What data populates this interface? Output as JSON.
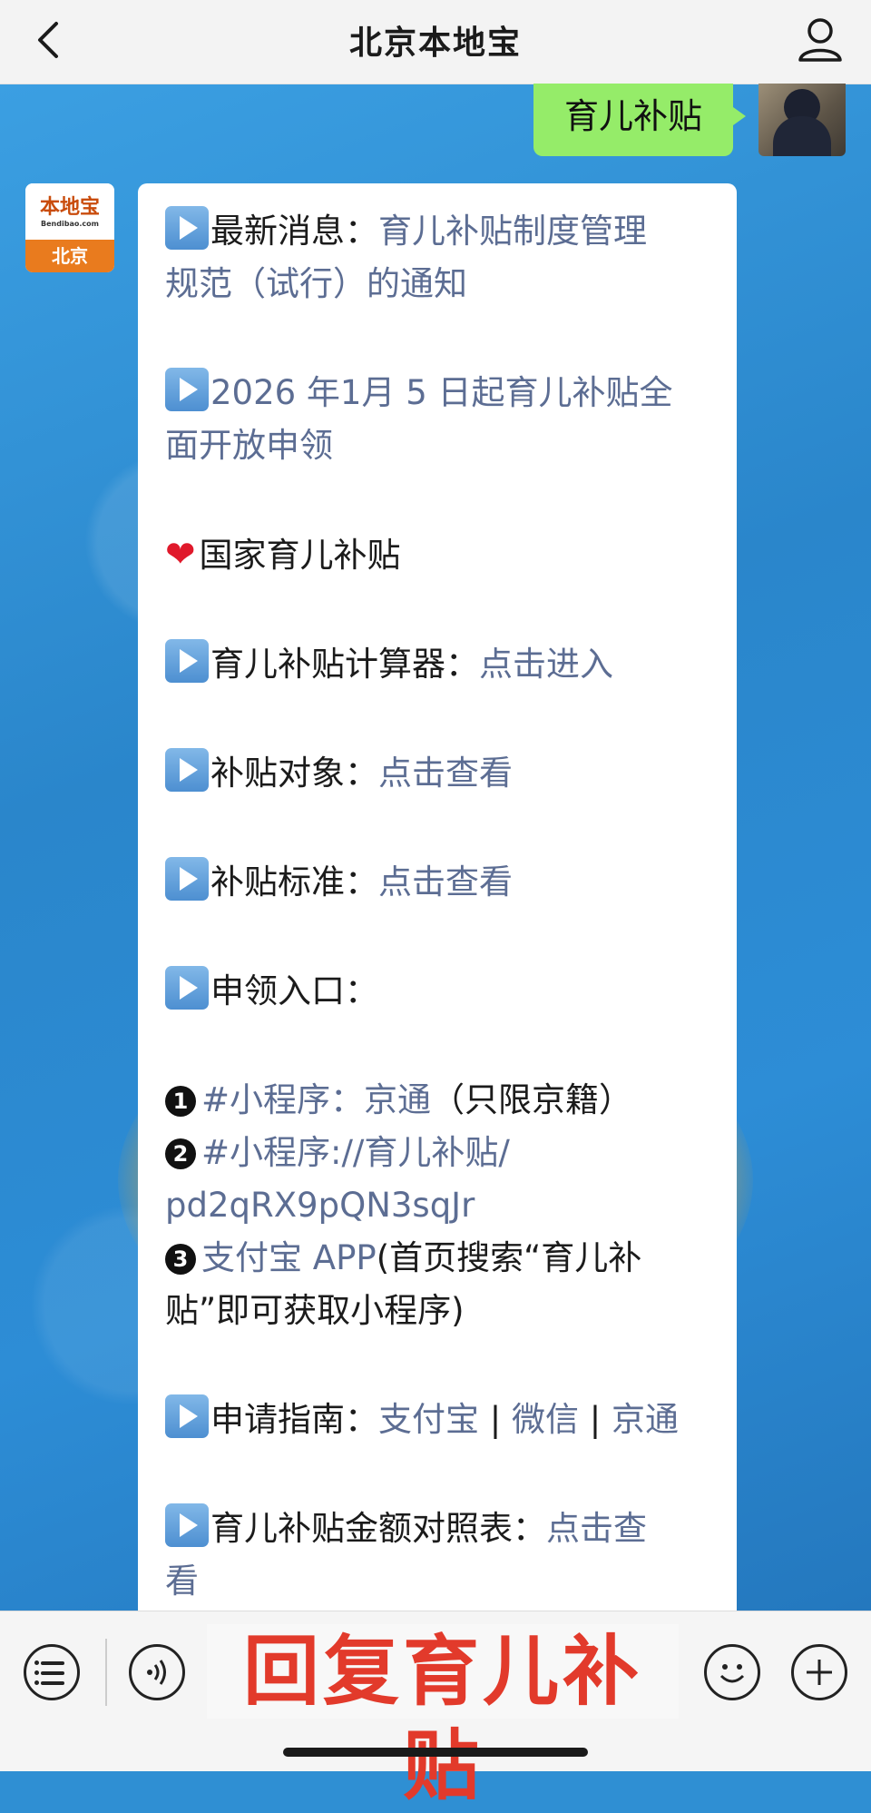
{
  "header": {
    "title": "北京本地宝"
  },
  "sent": {
    "text": "育儿补贴"
  },
  "bot": {
    "logo_main": "本地宝",
    "logo_sub": "Bendibao.com",
    "logo_city": "北京"
  },
  "message": {
    "l1_prefix": "最新消息：",
    "l1_link": "育儿补贴制度管理",
    "l1_link2": "规范（试行）的通知",
    "l2_link": "2026 年1月 5 日起育儿补贴全",
    "l2_link2": "面开放申领",
    "l3": "国家育儿补贴",
    "l4_prefix": "育儿补贴计算器：",
    "l4_link": "点击进入",
    "l5_prefix": "补贴对象：",
    "l5_link": "点击查看",
    "l6_prefix": "补贴标准：",
    "l6_link": "点击查看",
    "l7": "申领入口：",
    "e1_link": "#小程序：京通",
    "e1_suffix": "（只限京籍）",
    "e2_link": "#小程序://育儿补贴/",
    "e2_link2": "pd2qRX9pQN3sqJr",
    "e3_link": "支付宝 APP",
    "e3_suffix": "(首页搜索“育儿补",
    "e3_suffix2": "贴”即可获取小程序)",
    "l8_prefix": "申请指南：",
    "l8_link1": "支付宝",
    "l8_sep1": " | ",
    "l8_link2": "微信",
    "l8_sep2": " | ",
    "l8_link3": "京通",
    "l9_prefix": "育儿补贴金额对照表：",
    "l9_link": "点击查",
    "l9_link2": "看"
  },
  "bottom": {
    "overlay_text": "回复育儿补贴"
  },
  "colors": {
    "link": "#5c6d93",
    "sent_bubble": "#95ec69",
    "overlay": "#e23a2b"
  }
}
